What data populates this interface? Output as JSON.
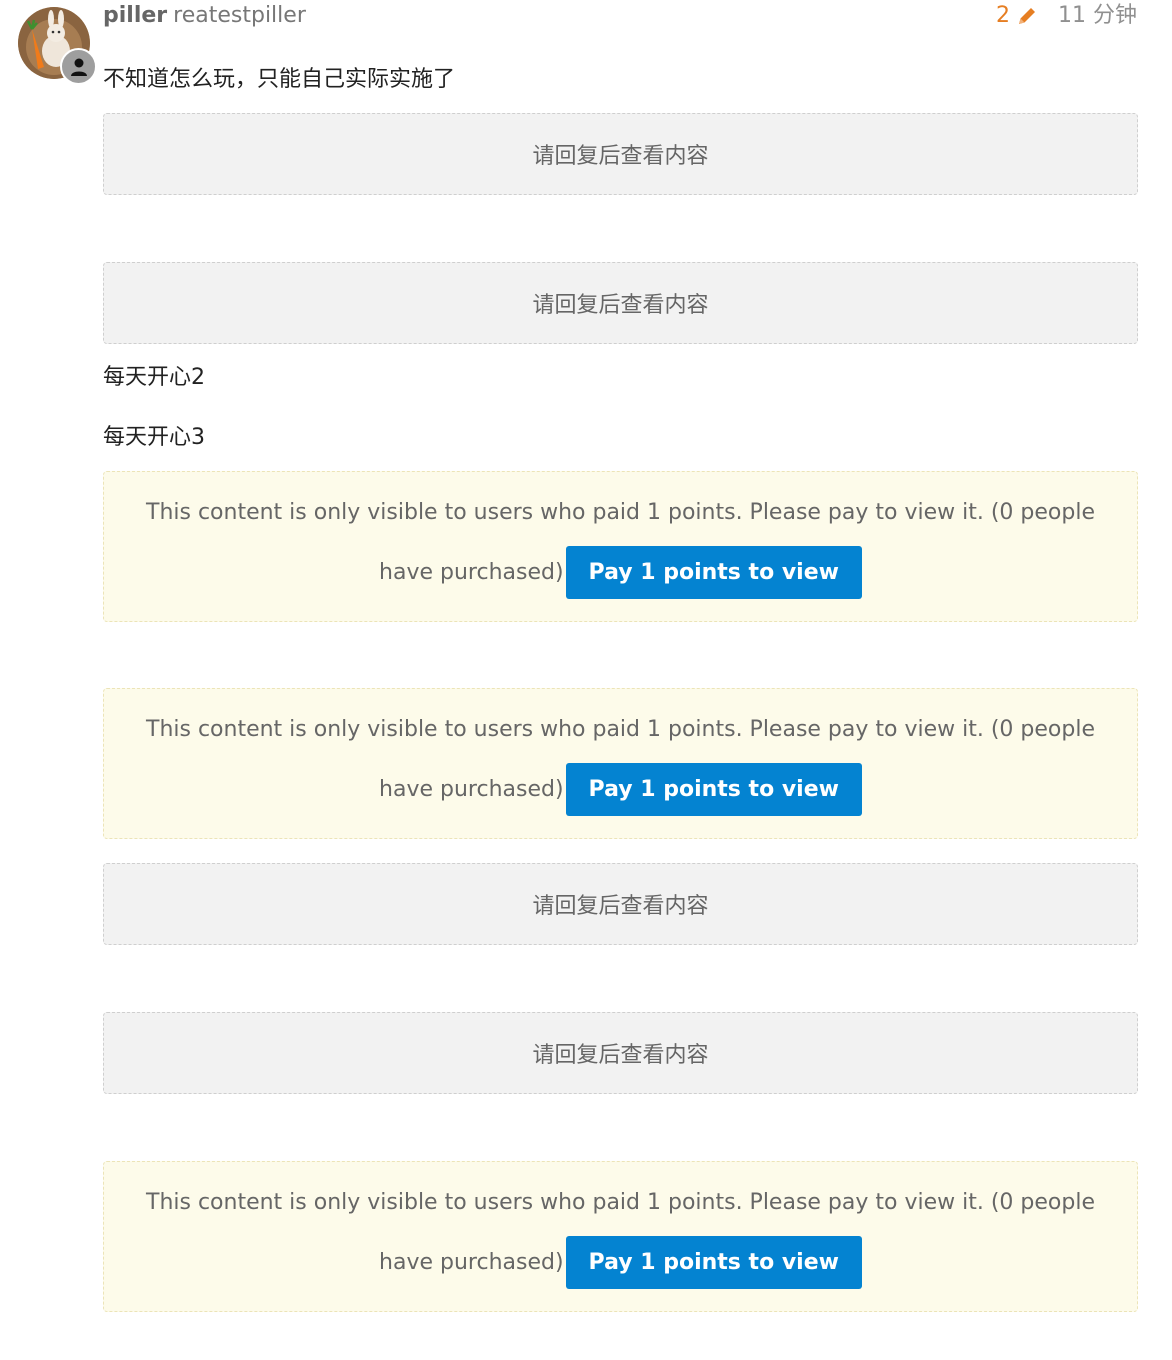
{
  "post": {
    "username": "piller",
    "full_name": "reatestpiller",
    "edit_count": "2",
    "time_ago": "11 分钟",
    "intro_text": "不知道怎么玩，只能自己实际实施了",
    "daily_line_1": "每天开心2",
    "daily_line_2": "每天开心3"
  },
  "hidden_blocks": [
    {
      "message": "请回复后查看内容"
    },
    {
      "message": "请回复后查看内容"
    },
    {
      "message": "请回复后查看内容"
    },
    {
      "message": "请回复后查看内容"
    }
  ],
  "paid_blocks": [
    {
      "message_line1": "This content is only visible to users who paid 1 points. Please pay to view it. (0 people",
      "message_line2": "have purchased)",
      "button_label": "Pay 1 points to view"
    },
    {
      "message_line1": "This content is only visible to users who paid 1 points. Please pay to view it. (0 people",
      "message_line2": "have purchased)",
      "button_label": "Pay 1 points to view"
    },
    {
      "message_line1": "This content is only visible to users who paid 1 points. Please pay to view it. (0 people",
      "message_line2": "have purchased)",
      "button_label": "Pay 1 points to view"
    }
  ],
  "icons": {
    "edit": "pencil-icon",
    "badge": "user-icon",
    "avatar": "rabbit-with-carrot"
  },
  "colors": {
    "edit_accent": "#e67e22",
    "pay_button": "#0483d1",
    "paid_box_bg": "#fdfbea",
    "hidden_box_bg": "#f2f2f2"
  }
}
